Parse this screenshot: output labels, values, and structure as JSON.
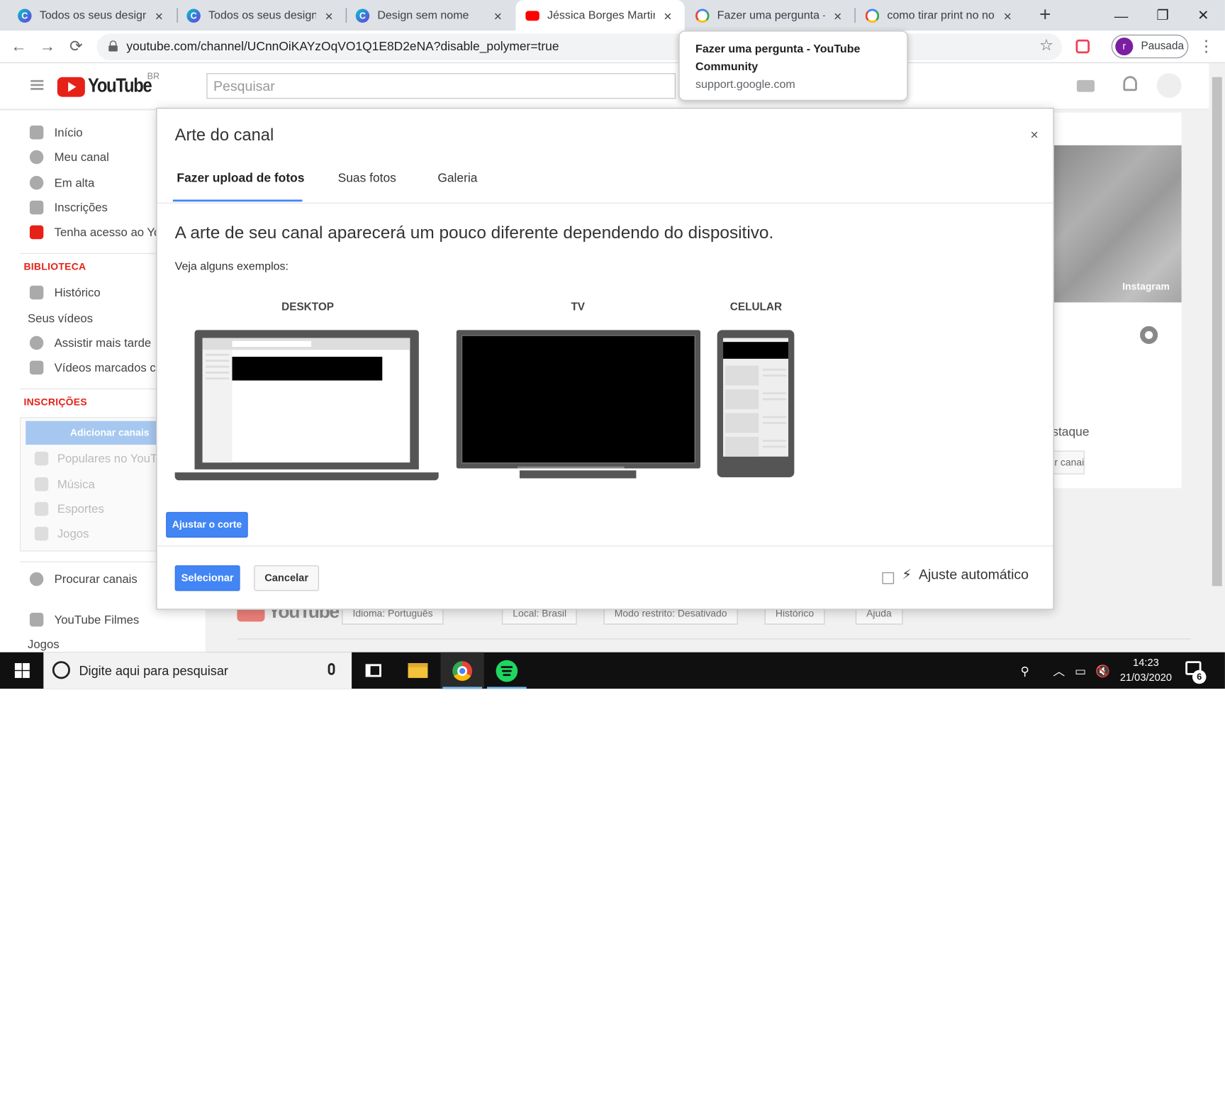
{
  "browser": {
    "tabs": [
      {
        "title": "Todos os seus designs -",
        "favicon": "canva-icon"
      },
      {
        "title": "Todos os seus designs -",
        "favicon": "canva-icon"
      },
      {
        "title": "Design sem nome",
        "favicon": "canva-icon"
      },
      {
        "title": "Jéssica Borges Martins",
        "favicon": "youtube-icon",
        "active": true
      },
      {
        "title": "Fazer uma pergunta - Y",
        "favicon": "google-icon"
      },
      {
        "title": "como tirar print no not",
        "favicon": "google-icon"
      }
    ],
    "tab_close_glyph": "×",
    "new_tab_glyph": "+",
    "window_controls": {
      "minimize": "—",
      "restore": "❐",
      "close": "✕"
    },
    "nav": {
      "back": "←",
      "forward": "→",
      "reload": "⟳"
    },
    "url": "youtube.com/channel/UCnnOiKAYzOqVO1Q1E8D2eNA?disable_polymer=true",
    "star_glyph": "☆",
    "profile": {
      "initial": "r",
      "status": "Pausada"
    },
    "menu_glyph": "⋮"
  },
  "tooltip": {
    "title": "Fazer uma pergunta - YouTube Community",
    "domain": "support.google.com"
  },
  "youtube": {
    "logo_word": "YouTube",
    "region": "BR",
    "search_placeholder": "Pesquisar",
    "sidebar": {
      "main_items": [
        "Início",
        "Meu canal",
        "Em alta",
        "Inscrições",
        "Tenha acesso ao YouTube Premium"
      ],
      "library_header": "BIBLIOTECA",
      "library_items": [
        "Histórico",
        "Seus vídeos",
        "Assistir mais tarde",
        "Vídeos marcados com gostei"
      ],
      "subs_header": "INSCRIÇÕES",
      "add_channels": "Adicionar canais",
      "subs_items": [
        "Populares no YouTube",
        "Música",
        "Esportes",
        "Jogos"
      ],
      "browse_channels": "Procurar canais",
      "films": "YouTube Filmes",
      "games": "Jogos"
    },
    "channel": {
      "art_link": "Instagram",
      "featured_title": "Canais em destaque",
      "featured_button": "Adicionar canais"
    },
    "footer": {
      "logo_word": "YouTube",
      "buttons": [
        "Idioma: Português",
        "Local: Brasil",
        "Modo restrito: Desativado",
        "Histórico",
        "Ajuda"
      ]
    }
  },
  "dialog": {
    "title": "Arte do canal",
    "close_glyph": "×",
    "tabs": [
      "Fazer upload de fotos",
      "Suas fotos",
      "Galeria"
    ],
    "active_tab": "Fazer upload de fotos",
    "headline": "A arte de seu canal aparecerá um pouco diferente dependendo do dispositivo.",
    "subtext": "Veja alguns exemplos:",
    "devices": [
      "DESKTOP",
      "TV",
      "CELULAR"
    ],
    "crop_button": "Ajustar o corte",
    "select_button": "Selecionar",
    "cancel_button": "Cancelar",
    "auto_adjust": {
      "label": "Ajuste automático",
      "checked": false
    }
  },
  "taskbar": {
    "search_placeholder": "Digite aqui para pesquisar",
    "time": "14:23",
    "date": "21/03/2020",
    "notification_count": "6"
  }
}
